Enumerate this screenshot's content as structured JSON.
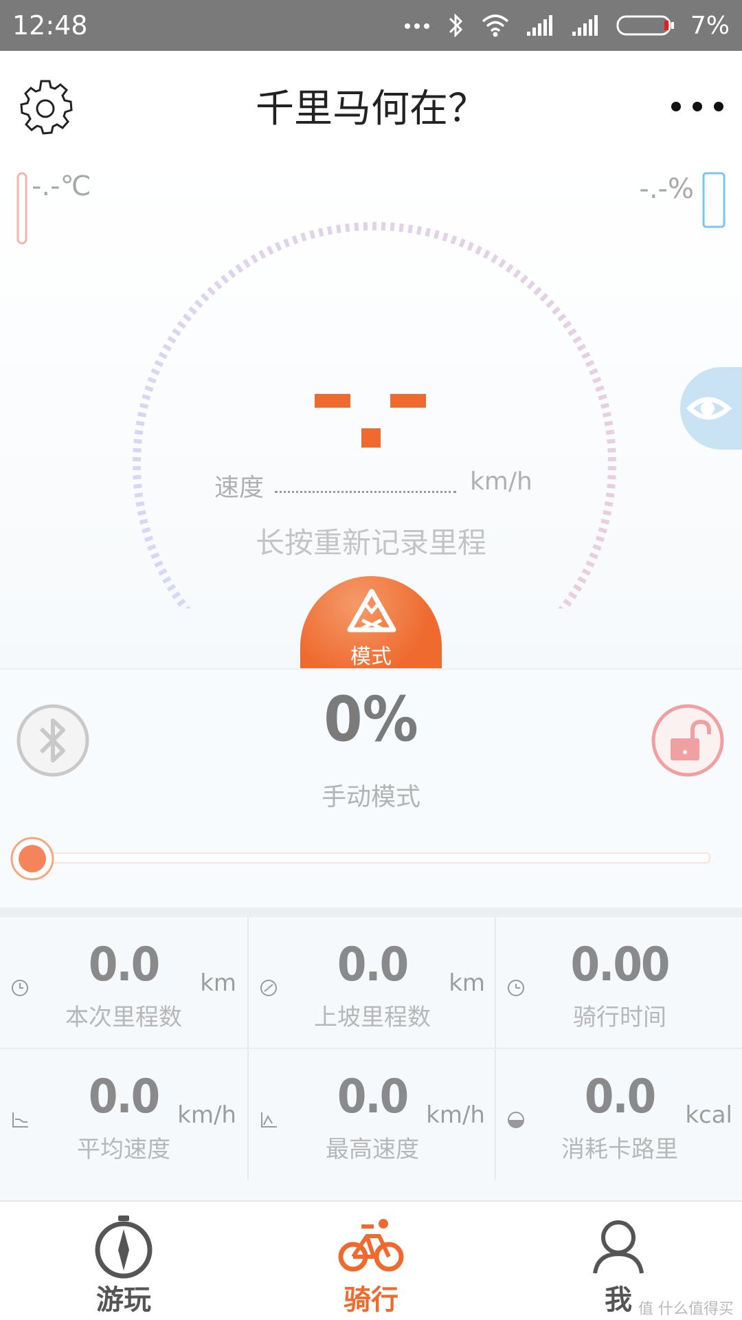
{
  "status_bar": {
    "time": "12:48",
    "battery_percent": "7%",
    "icons": [
      "more-dots-icon",
      "bluetooth-icon",
      "wifi-icon",
      "signal-icon",
      "signal-icon",
      "battery-icon"
    ]
  },
  "header": {
    "title": "千里马何在？",
    "settings_icon": "gear-icon",
    "more_icon": "more-dots-icon"
  },
  "gauges": {
    "temperature_text": "-.-℃",
    "battery_text": "-.-%"
  },
  "speedometer": {
    "speed_label": "速度",
    "speed_unit": "km/h",
    "reset_hint": "长按重新记录里程",
    "mode_button_label": "模式"
  },
  "control": {
    "assist_percent": "0%",
    "mode_name": "手动模式",
    "assist_level": 0
  },
  "stats": [
    {
      "icon": "clock-icon",
      "value": "0.0",
      "unit": "km",
      "label": "本次里程数"
    },
    {
      "icon": "slope-icon",
      "value": "0.0",
      "unit": "km",
      "label": "上坡里程数"
    },
    {
      "icon": "timer-icon",
      "value": "0.00",
      "unit": "",
      "label": "骑行时间"
    },
    {
      "icon": "avg-speed-icon",
      "value": "0.0",
      "unit": "km/h",
      "label": "平均速度"
    },
    {
      "icon": "max-speed-icon",
      "value": "0.0",
      "unit": "km/h",
      "label": "最高速度"
    },
    {
      "icon": "calorie-icon",
      "value": "0.0",
      "unit": "kcal",
      "label": "消耗卡路里"
    }
  ],
  "bottom_nav": [
    {
      "label": "游玩",
      "icon": "compass-icon",
      "active": false
    },
    {
      "label": "骑行",
      "icon": "bicycle-icon",
      "active": true
    },
    {
      "label": "我",
      "icon": "user-icon",
      "active": false
    }
  ],
  "watermark": "值 什么值得买",
  "colors": {
    "accent": "#EE6A2E",
    "status_bar": "#7A7A7A",
    "lock_red": "#F0A0A0",
    "battery_blue": "#7CC6EE"
  }
}
